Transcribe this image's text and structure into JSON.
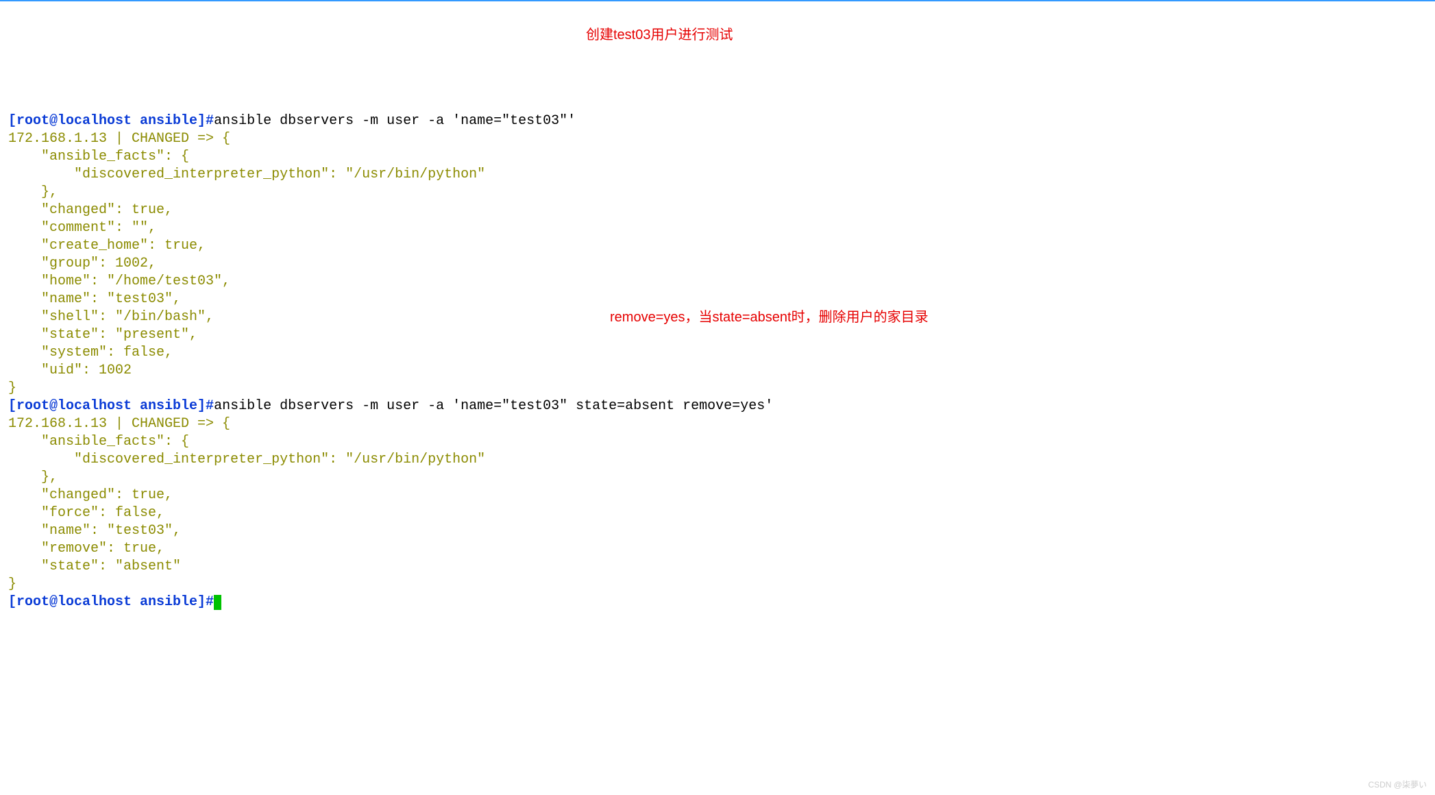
{
  "prompt1": "[root@localhost ansible]#",
  "cmd1": "ansible dbservers -m user -a 'name=\"test03\"'",
  "out1": "172.168.1.13 | CHANGED => {\n    \"ansible_facts\": {\n        \"discovered_interpreter_python\": \"/usr/bin/python\"\n    },\n    \"changed\": true,\n    \"comment\": \"\",\n    \"create_home\": true,\n    \"group\": 1002,\n    \"home\": \"/home/test03\",\n    \"name\": \"test03\",\n    \"shell\": \"/bin/bash\",\n    \"state\": \"present\",\n    \"system\": false,\n    \"uid\": 1002\n}",
  "prompt2": "[root@localhost ansible]#",
  "cmd2": "ansible dbservers -m user -a 'name=\"test03\" state=absent remove=yes'",
  "out2": "172.168.1.13 | CHANGED => {\n    \"ansible_facts\": {\n        \"discovered_interpreter_python\": \"/usr/bin/python\"\n    },\n    \"changed\": true,\n    \"force\": false,\n    \"name\": \"test03\",\n    \"remove\": true,\n    \"state\": \"absent\"\n}",
  "prompt3": "[root@localhost ansible]#",
  "anno1": "创建test03用户进行测试",
  "anno2": "remove=yes，当state=absent时，删除用户的家目录",
  "watermark": "CSDN @柒夢い"
}
